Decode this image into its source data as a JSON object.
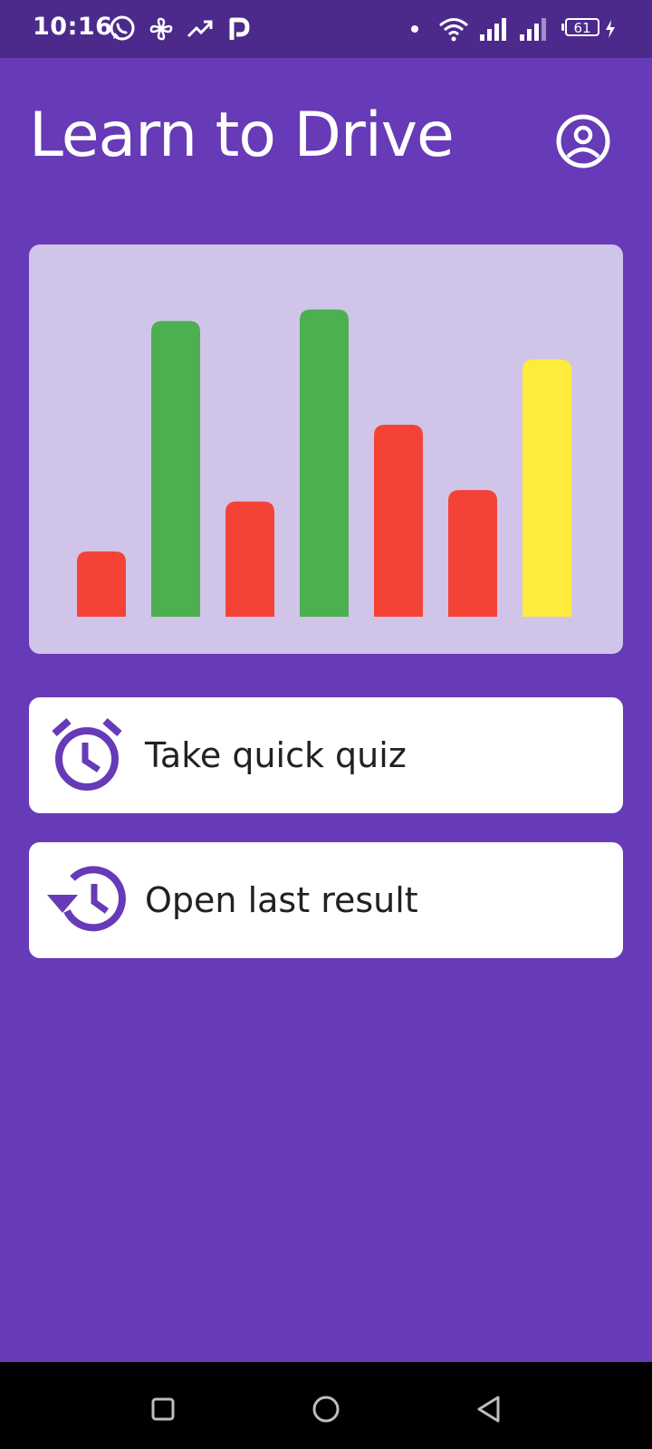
{
  "status_bar": {
    "time": "10:16",
    "battery_level": "61",
    "icons": [
      "whatsapp-icon",
      "pinwheel-icon",
      "trending-up-icon",
      "parking-icon",
      "notification-dot-icon",
      "wifi-icon",
      "signal-icon",
      "signal-icon",
      "battery-icon",
      "charging-icon"
    ]
  },
  "header": {
    "title": "Learn to Drive",
    "profile_icon": "account-circle-icon"
  },
  "chart_data": {
    "type": "bar",
    "values": [
      0.17,
      0.77,
      0.3,
      0.8,
      0.5,
      0.33,
      0.67
    ],
    "colors": [
      "#f44336",
      "#4caf50",
      "#f44336",
      "#4caf50",
      "#f44336",
      "#f44336",
      "#ffeb3b"
    ]
  },
  "actions": [
    {
      "label": "Take quick quiz",
      "icon": "alarm-clock-icon"
    },
    {
      "label": "Open last result",
      "icon": "history-icon"
    }
  ],
  "nav_bar": {
    "icons": [
      "recents-square-icon",
      "home-circle-icon",
      "back-triangle-icon"
    ]
  },
  "colors": {
    "primary": "#673ab7",
    "status_bar": "#4b2a8c",
    "chart_background": "#d1c4e9",
    "accent_icon": "#673ab7"
  }
}
